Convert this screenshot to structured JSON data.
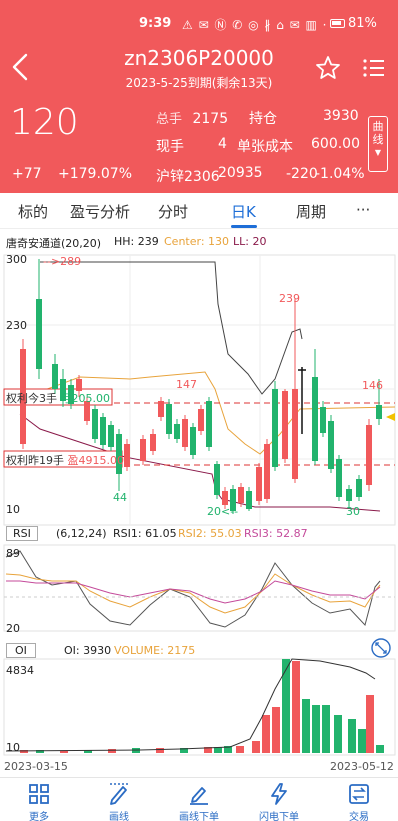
{
  "status_bar": {
    "time": "9:39",
    "icons": "⚠ ✉ Ⓝ ✆ ◎ ∦ ⌂ ✉ ▥ ·",
    "battery": "81%"
  },
  "header": {
    "title": "zn2306P20000",
    "subtitle": "2023-5-25到期(剩余13天)",
    "price": "120",
    "change_abs": "+77",
    "change_pct": "+179.07%",
    "stats": {
      "total_volume_label": "总手",
      "total_volume": "2175",
      "open_interest_label": "持仓",
      "open_interest": "3930",
      "current_volume_label": "现手",
      "current_volume": "4",
      "unit_cost_label": "单张成本",
      "unit_cost": "600.00",
      "underlying_label": "沪锌2306",
      "underlying_price": "20935",
      "underlying_change": "-220",
      "underlying_change_pct": "-1.04%"
    },
    "side_tag": {
      "line1": "曲",
      "line2": "线",
      "arrow": "▼"
    }
  },
  "tabs": {
    "items": [
      "标的",
      "盈亏分析",
      "分时",
      "日K",
      "周期",
      "···"
    ],
    "active": "日K"
  },
  "chart": {
    "indicator_name": "唐奇安通道",
    "indicator_params": "(20,20)",
    "hh": "HH: 239",
    "center": "Center: 130",
    "ll": "LL: 20",
    "y_top": "300",
    "y_mid": "230",
    "y_bottom": "10",
    "high_annotation": "-->289",
    "peak_label": "239",
    "label_147": "147",
    "label_146": "146",
    "low_44": "44",
    "low_20": "20<--",
    "low_30": "30",
    "position_today": "权利今3手",
    "position_today_pnl": "亏205.00",
    "position_prev": "权利昨19手",
    "position_prev_pnl": "盈4915.00",
    "rsi": {
      "name": "RSI",
      "params": "(6,12,24)",
      "rsi1": "RSI1: 61.05",
      "rsi2": "RSI2: 55.03",
      "rsi3": "RSI3: 52.87",
      "y_top": "89",
      "y_bottom": "20"
    },
    "oi": {
      "name": "OI",
      "oi_value": "OI: 3930",
      "volume": "VOLUME: 2175",
      "y_top": "4834",
      "y_bottom": "10"
    },
    "date_start": "2023-03-15",
    "date_end": "2023-05-12",
    "colors": {
      "up": "#f1595b",
      "down": "#22b36d",
      "center": "#e8a33b",
      "rsi1": "#555555",
      "rsi2": "#e8a33b",
      "rsi3": "#c44a9a",
      "accent": "#1e6ed7"
    }
  },
  "bottom_bar": {
    "items": [
      {
        "label": "更多",
        "icon": "grid-icon"
      },
      {
        "label": "画线",
        "icon": "pencil-icon"
      },
      {
        "label": "画线下单",
        "icon": "draw-order-icon"
      },
      {
        "label": "闪电下单",
        "icon": "lightning-icon"
      },
      {
        "label": "交易",
        "icon": "exchange-icon"
      }
    ]
  }
}
